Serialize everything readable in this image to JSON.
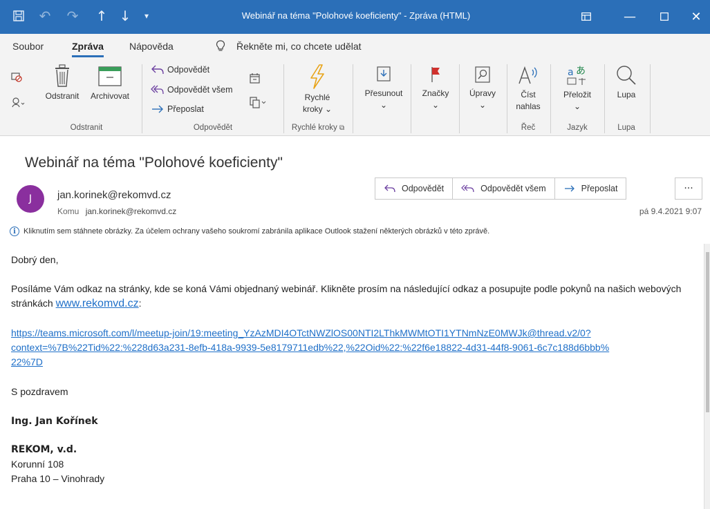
{
  "window": {
    "title": "Webinář na téma \"Polohové koeficienty\"  -  Zpráva (HTML)",
    "accent": "#2b6fb8"
  },
  "quick_access": [
    "save-icon",
    "undo-icon",
    "redo-icon",
    "arrow-up-icon",
    "arrow-down-icon",
    "customize-icon"
  ],
  "menu": {
    "items": [
      "Soubor",
      "Zpráva",
      "Nápověda"
    ],
    "active": "Zpráva",
    "tell_me": "Řekněte mi, co chcete udělat"
  },
  "ribbon": {
    "delete_group": {
      "label": "Odstranit",
      "delete": "Odstranit",
      "archive": "Archivovat"
    },
    "respond_group": {
      "label": "Odpovědět",
      "reply": "Odpovědět",
      "reply_all": "Odpovědět všem",
      "forward": "Přeposlat"
    },
    "quicksteps_group": {
      "label": "Rychlé kroky",
      "button_line1": "Rychlé",
      "button_line2": "kroky"
    },
    "move": "Přesunout",
    "tags": "Značky",
    "edit": "Úpravy",
    "speech_group": {
      "label": "Řeč",
      "line1": "Číst",
      "line2": "nahlas"
    },
    "language_group": {
      "label": "Jazyk",
      "translate": "Přeložit"
    },
    "zoom_group": {
      "label": "Lupa",
      "zoom": "Lupa"
    }
  },
  "message": {
    "subject": "Webinář na téma \"Polohové koeficienty\"",
    "avatar_initial": "J",
    "from": "jan.korinek@rekomvd.cz",
    "to_label": "Komu",
    "to": "jan.korinek@rekomvd.cz",
    "date": "pá 9.4.2021 9:07",
    "actions": {
      "reply": "Odpovědět",
      "reply_all": "Odpovědět všem",
      "forward": "Přeposlat",
      "more": "···"
    },
    "info_bar": "Kliknutím sem stáhnete obrázky. Za účelem ochrany vašeho soukromí zabránila aplikace Outlook stažení některých obrázků v této zprávě."
  },
  "body": {
    "greeting": "Dobrý den,",
    "para1_a": "Posíláme Vám odkaz na stránky, kde se koná Vámi objednaný webinář. Klikněte prosím na následující odkaz a posupujte podle pokynů na našich webových stránkách ",
    "para1_link": "www.rekomvd.cz",
    "para1_b": ":",
    "teams_link_line1": "https://teams.microsoft.com/l/meetup-join/19:meeting_YzAzMDI4OTctNWZlOS00NTI2LThkMWMtOTI1YTNmNzE0MWJk@thread.v2/0?",
    "teams_link_line2": "context=%7B%22Tid%22:%228d63a231-8efb-418a-9939-5e8179711edb%22,%22Oid%22:%22f6e18822-4d31-44f8-9061-6c7c188d6bbb%",
    "teams_link_line3": "22%7D",
    "closing": "S pozdravem",
    "signature_name": "Ing. Jan Kořínek",
    "company": "REKOM, v.d.",
    "address1": "Korunní 108",
    "address2": "Praha 10 – Vinohrady"
  }
}
